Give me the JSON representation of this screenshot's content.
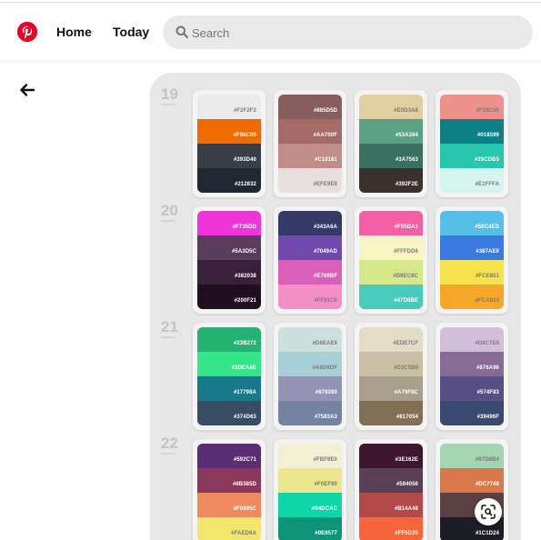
{
  "header": {
    "home_label": "Home",
    "today_label": "Today",
    "search_placeholder": "Search",
    "brand_color": "#e60023"
  },
  "icons": [
    "pinterest-logo-icon",
    "search-icon",
    "back-arrow-icon",
    "visual-search-icon"
  ],
  "palette_rows": [
    {
      "day": "19",
      "palettes": [
        [
          "#F2F2F2",
          "#F96C00",
          "#393D46",
          "#212832"
        ],
        [
          "#885D5D",
          "#AA700F",
          "#C18181",
          "#EFE9E9"
        ],
        [
          "#E0D3A8",
          "#53A384",
          "#3A7563",
          "#392F2E"
        ],
        [
          "#F28C59",
          "#018599",
          "#29CDB5",
          "#E1FFFA"
        ]
      ],
      "swatch_colors": [
        [
          "#ebebeb",
          "#f06a00",
          "#393d46",
          "#212832"
        ],
        [
          "#885d5d",
          "#a36a66",
          "#c08d88",
          "#e6dfde"
        ],
        [
          "#e0cfa0",
          "#5aa283",
          "#3a7060",
          "#3a302e"
        ],
        [
          "#ee918a",
          "#0e7f86",
          "#29c6ae",
          "#d7f5ef"
        ]
      ]
    },
    {
      "day": "20",
      "palettes": [
        [
          "#F735DD",
          "#5A3D5C",
          "#382038",
          "#200F21"
        ],
        [
          "#343A6A",
          "#7049AD",
          "#E769BF",
          "#FF91C6"
        ],
        [
          "#F55DA1",
          "#FFFDD6",
          "#D8EC8C",
          "#47D0BE"
        ],
        [
          "#59C4ED",
          "#387AE0",
          "#FCE851",
          "#FCA924"
        ]
      ],
      "swatch_colors": [
        [
          "#ef35d8",
          "#5a3d5c",
          "#382038",
          "#200f21"
        ],
        [
          "#333a68",
          "#7049ad",
          "#d95fb8",
          "#f38fc4"
        ],
        [
          "#f55fa3",
          "#f8f4c4",
          "#d6e88a",
          "#47ccbb"
        ],
        [
          "#56bfe8",
          "#3a7ae0",
          "#f6e24c",
          "#f5a72a"
        ]
      ]
    },
    {
      "day": "21",
      "palettes": [
        [
          "#23B272",
          "#3DEA8E",
          "#17798A",
          "#374D63"
        ],
        [
          "#D6EAE9",
          "#A8D6DF",
          "#979280",
          "#7583A3"
        ],
        [
          "#EDE7CF",
          "#D3C5B0",
          "#A79F8C",
          "#817054"
        ],
        [
          "#D9C7E0",
          "#876A96",
          "#574F83",
          "#39496F"
        ]
      ],
      "swatch_colors": [
        [
          "#23b272",
          "#34e58a",
          "#17798a",
          "#374d63"
        ],
        [
          "#cde0de",
          "#a7d0d6",
          "#9394b5",
          "#7583a3"
        ],
        [
          "#e3dcc4",
          "#c9bfa3",
          "#a79f8c",
          "#817054"
        ],
        [
          "#d1bfd9",
          "#876a96",
          "#574f83",
          "#39496f"
        ]
      ]
    },
    {
      "day": "22",
      "palettes": [
        [
          "#592C71",
          "#8B385D",
          "#F0895C",
          "#FAED6A"
        ],
        [
          "#FBF9E0",
          "#F0EF89",
          "#04DCAC",
          "#0E9577"
        ],
        [
          "#3E162E",
          "#594056",
          "#B14A48",
          "#FF5D35"
        ],
        [
          "#97D8B4",
          "#DC7748",
          "",
          "#1C1D24"
        ]
      ],
      "swatch_colors": [
        [
          "#5b2d73",
          "#8c385d",
          "#ee8a5e",
          "#f3e66c"
        ],
        [
          "#f1efd4",
          "#ece78f",
          "#0ed6a8",
          "#0e9577"
        ],
        [
          "#3e162e",
          "#594056",
          "#b14a48",
          "#f7663a"
        ],
        [
          "#a4d4b2",
          "#d9794b",
          "#5a4040",
          "#1c1d24"
        ]
      ]
    }
  ]
}
